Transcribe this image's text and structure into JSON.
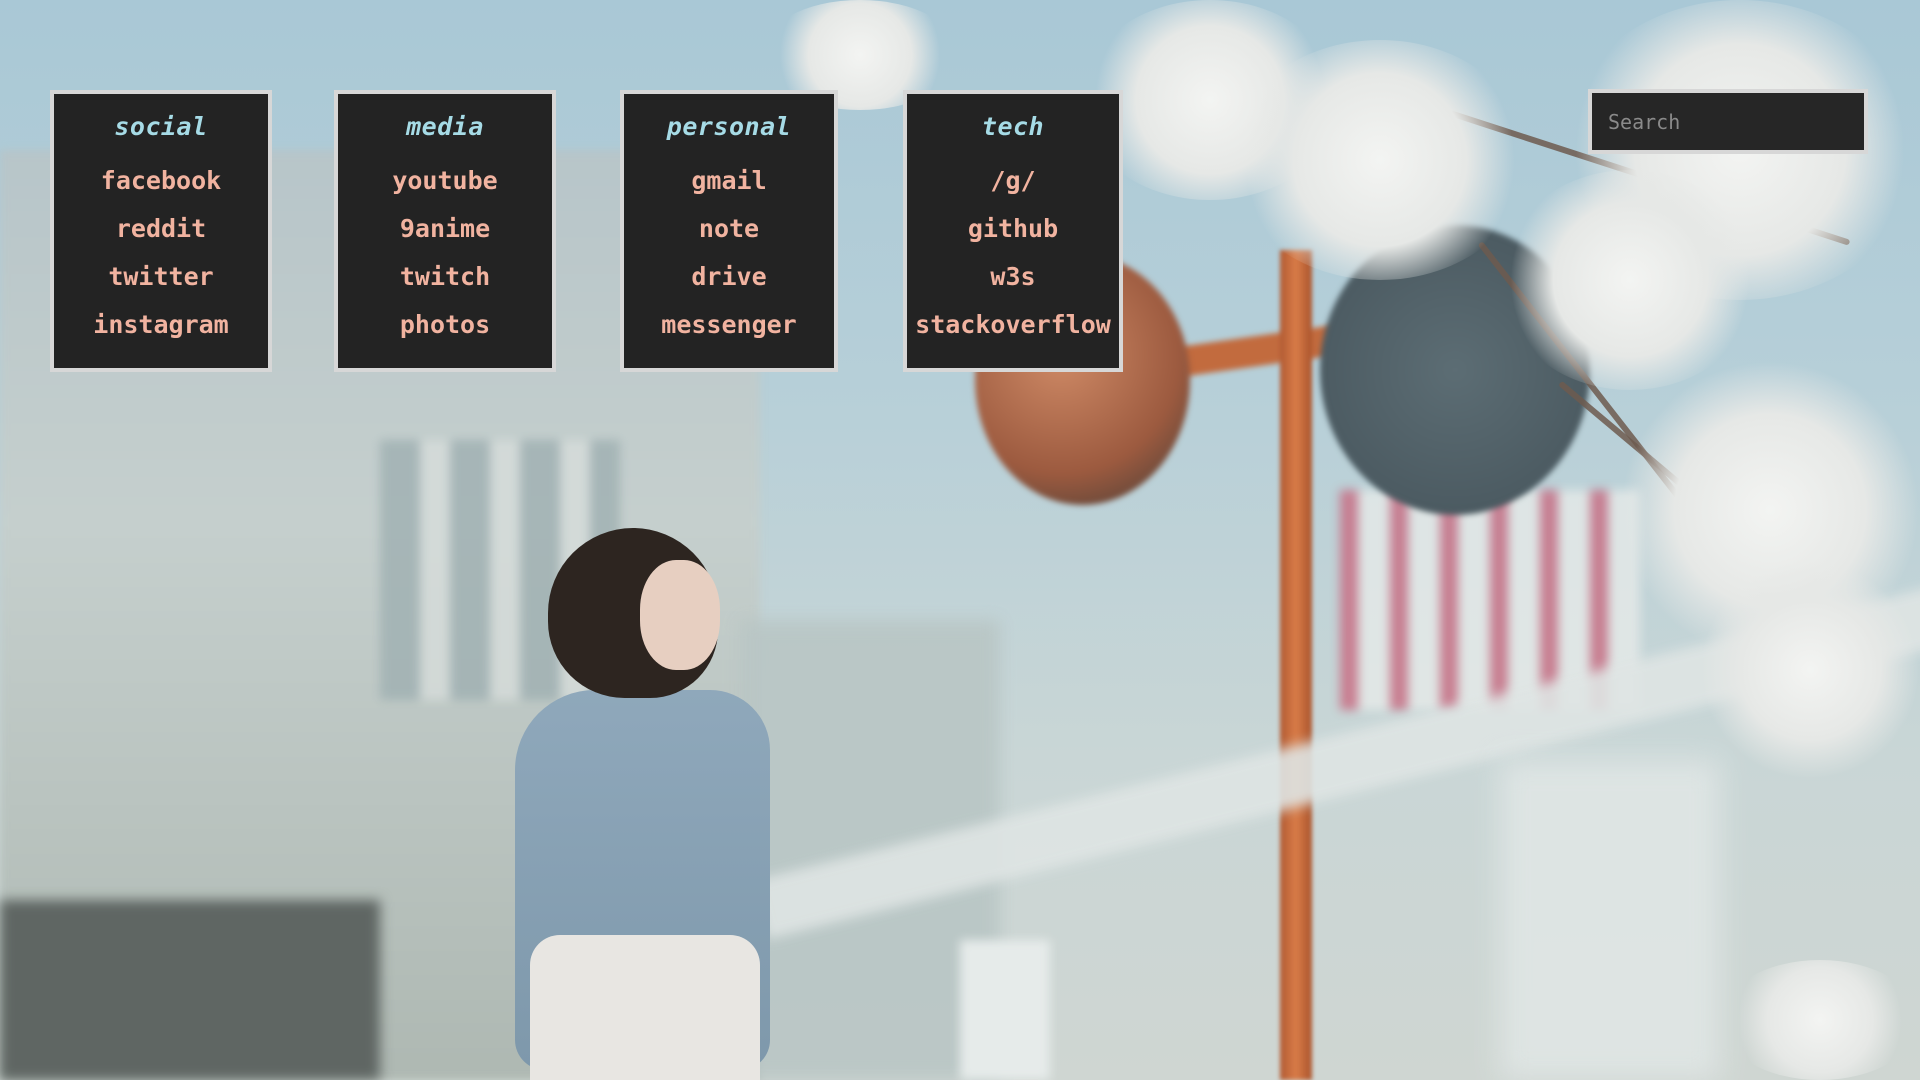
{
  "search": {
    "placeholder": "Search"
  },
  "groups": [
    {
      "title": "social",
      "links": [
        "facebook",
        "reddit",
        "twitter",
        "instagram"
      ]
    },
    {
      "title": "media",
      "links": [
        "youtube",
        "9anime",
        "twitch",
        "photos"
      ]
    },
    {
      "title": "personal",
      "links": [
        "gmail",
        "note",
        "drive",
        "messenger"
      ]
    },
    {
      "title": "tech",
      "links": [
        "/g/",
        "github",
        "w3s",
        "stackoverflow"
      ]
    }
  ],
  "colors": {
    "card_background": "#232323",
    "card_border": "#d7d7d7",
    "title": "#a6dbe6",
    "link": "#f1b3a0",
    "search_background": "#262626"
  }
}
